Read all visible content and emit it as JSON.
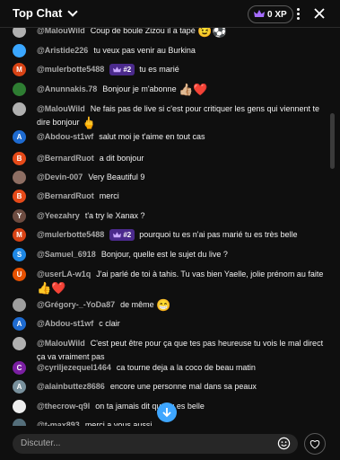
{
  "header": {
    "title": "Top Chat",
    "xp": "0 XP",
    "icons": [
      "chevron-down-icon",
      "crown-icon",
      "more-vert-icon",
      "close-icon"
    ]
  },
  "messages": [
    {
      "author": "@MalouWild",
      "text": "Coup de boule Zizou il a tapé",
      "emoji": "😉⚽",
      "avatar": "photo",
      "color": "#b0b0b0"
    },
    {
      "author": "@Aristide226",
      "text": "tu veux pas venir au Burkina",
      "avatar": "photo",
      "color": "#3aa6ff"
    },
    {
      "author": "@mulerbotte5488",
      "badge": "#2",
      "text": "tu es marié",
      "avatar": "M",
      "color": "#d84315"
    },
    {
      "author": "@Anunnakis.78",
      "text": "Bonjour je m'abonne",
      "emoji": "👍🏼❤️",
      "avatar": "photo",
      "color": "#2e7d32"
    },
    {
      "author": "@MalouWild",
      "text": "Ne fais pas de live si c'est pour critiquer les gens qui viennent te dire bonjour",
      "emoji": "🖕",
      "avatar": "photo",
      "color": "#b0b0b0"
    },
    {
      "author": "@Abdou-st1wf",
      "text": "salut moi je t'aime en tout cas",
      "avatar": "A",
      "color": "#1e6bd1"
    },
    {
      "author": "@BernardRuot",
      "text": "a dit bonjour",
      "avatar": "B",
      "color": "#e64a19"
    },
    {
      "author": "@Devin-007",
      "text": "Very Beautiful 9",
      "avatar": "photo",
      "color": "#8d6e63"
    },
    {
      "author": "@BernardRuot",
      "text": "merci",
      "avatar": "B",
      "color": "#e64a19"
    },
    {
      "author": "@Yeezahry",
      "text": "t'a try le Xanax ?",
      "avatar": "Y",
      "color": "#6d4c41"
    },
    {
      "author": "@mulerbotte5488",
      "badge": "#2",
      "text": "pourquoi tu es n'ai pas marié tu es très belle",
      "avatar": "M",
      "color": "#d84315"
    },
    {
      "author": "@Samuel_6918",
      "text": "Bonjour, quelle est le sujet du live ?",
      "avatar": "S",
      "color": "#1e88e5"
    },
    {
      "author": "@userLA-w1q",
      "text": "J'ai parlé de toi à tahis. Tu vas bien Yaelle, jolie prénom au faite",
      "emoji": "👍❤️",
      "avatar": "U",
      "color": "#e65100"
    },
    {
      "author": "@Grégory-_-YoDa87",
      "text": "de même",
      "emoji": "😁",
      "avatar": "photo",
      "color": "#9e9e9e"
    },
    {
      "author": "@Abdou-st1wf",
      "text": "c clair",
      "avatar": "A",
      "color": "#1e6bd1"
    },
    {
      "author": "@MalouWild",
      "text": "C'est peut être pour ça que tes pas heureuse tu vois le mal direct ça va vraiment pas",
      "avatar": "photo",
      "color": "#b0b0b0"
    },
    {
      "author": "@cyriljezequel1464",
      "text": "ca tourne deja a la coco de beau matin",
      "avatar": "C",
      "color": "#7b1fa2"
    },
    {
      "author": "@alainbuttez8686",
      "text": "encore une personne mal dans sa peaux",
      "avatar": "A",
      "color": "#78909c"
    },
    {
      "author": "@thecrow-q9l",
      "text": "on ta jamais dit que tu es belle",
      "avatar": "photo",
      "color": "#eeeeee"
    },
    {
      "author": "@t-max893",
      "text": "merci a vous aussi",
      "avatar": "photo",
      "color": "#546e7a"
    }
  ],
  "input": {
    "placeholder": "Discuter..."
  },
  "colors": {
    "background": "#0f0f0f",
    "author": "#aaaaaa",
    "badge": "#4b2a8c",
    "accent": "#3ea6ff"
  }
}
